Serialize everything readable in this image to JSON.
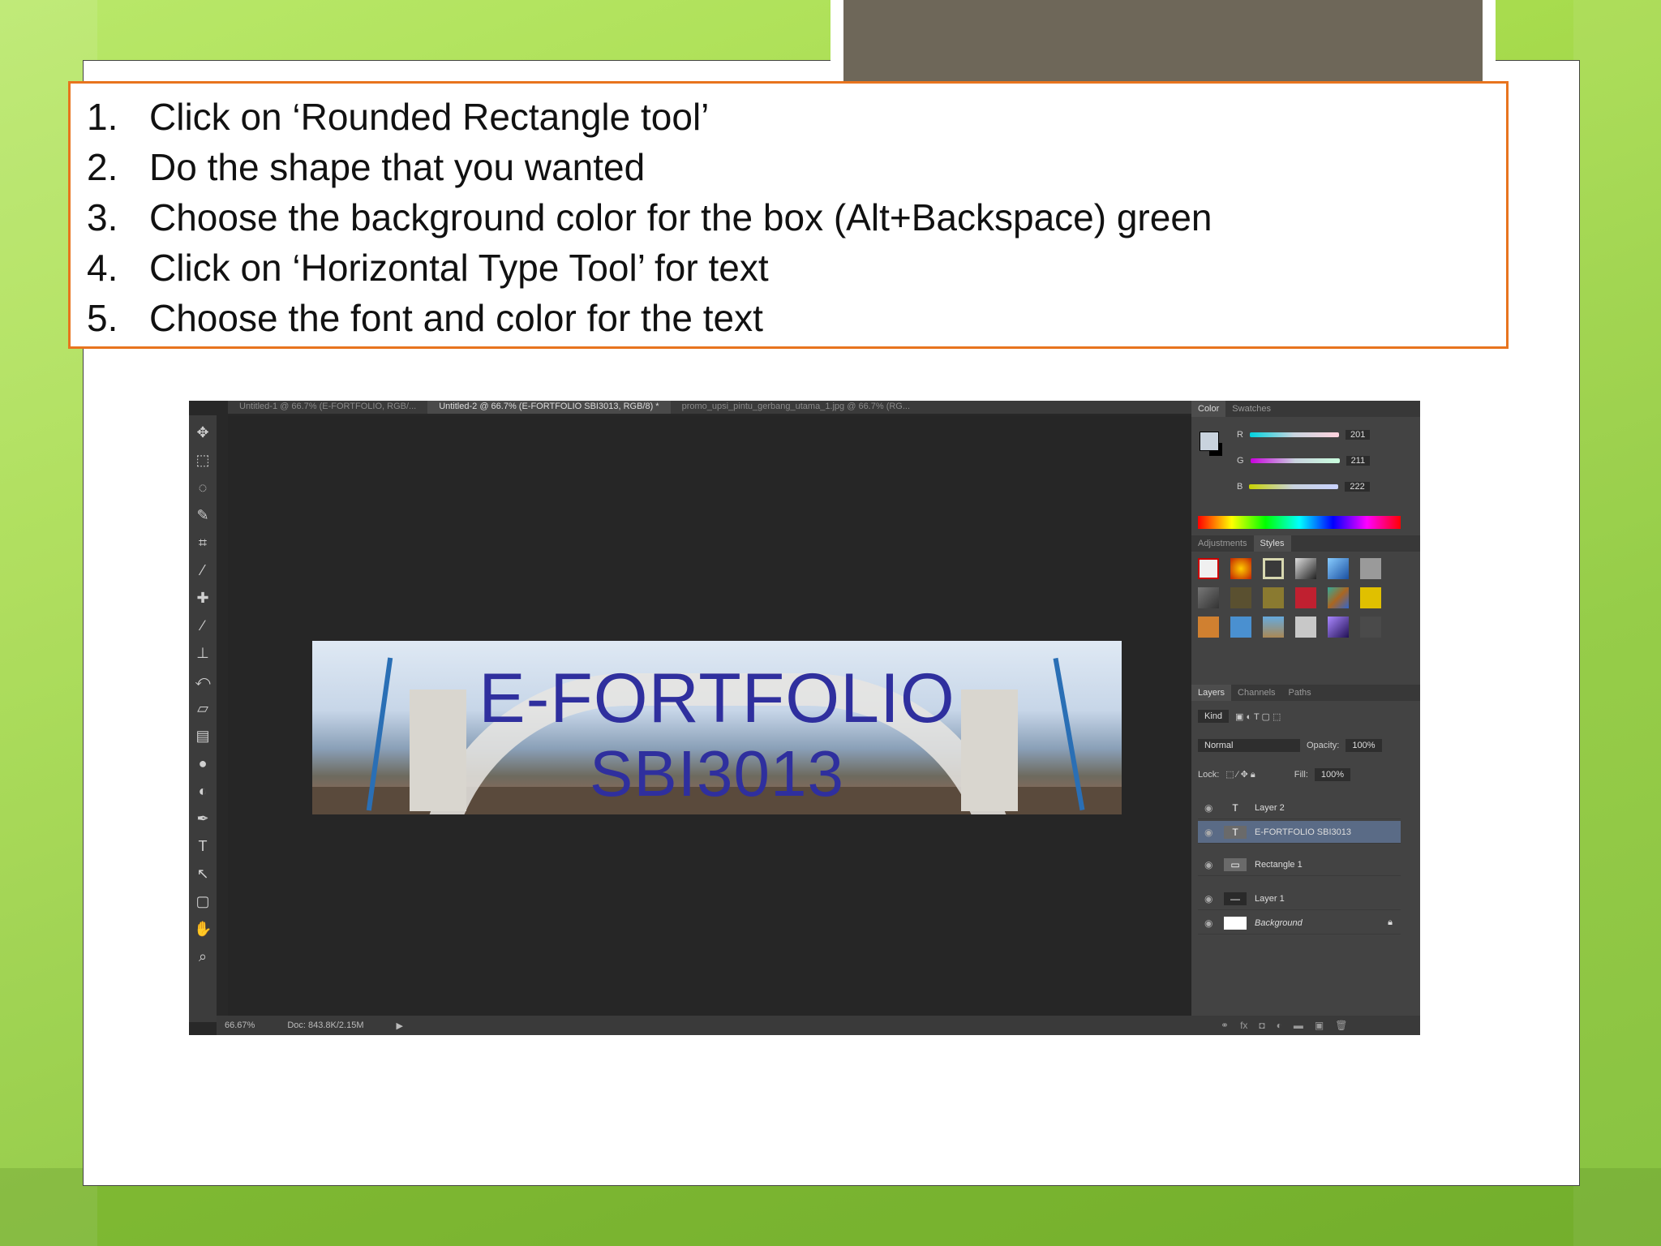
{
  "instructions": [
    {
      "num": "1.",
      "text": "Click on ‘Rounded Rectangle tool’"
    },
    {
      "num": "2.",
      "text": "Do the shape that you wanted"
    },
    {
      "num": "3.",
      "text": "Choose the background color for the box (Alt+Backspace) green"
    },
    {
      "num": "4.",
      "text": "Click on ‘Horizontal Type Tool’ for text"
    },
    {
      "num": "5.",
      "text": "Choose the font and color for the text"
    }
  ],
  "photoshop": {
    "tabs": [
      "Untitled-1 @ 66.7% (E-FORTFOLIO, RGB/...",
      "Untitled-2 @ 66.7% (E-FORTFOLIO SBI3013, RGB/8) *",
      "promo_upsi_pintu_gerbang_utama_1.jpg @ 66.7% (RG..."
    ],
    "banner_line1": "E-FORTFOLIO",
    "banner_line2": "SBI3013",
    "status_zoom": "66.67%",
    "status_doc": "Doc: 843.8K/2.15M",
    "color_tabs": [
      "Color",
      "Swatches"
    ],
    "color_values": {
      "r": "201",
      "g": "211",
      "b": "222"
    },
    "style_tabs": [
      "Adjustments",
      "Styles"
    ],
    "layer_tabs": [
      "Layers",
      "Channels",
      "Paths"
    ],
    "layer_kind": "Kind",
    "blend_mode": "Normal",
    "opacity_label": "Opacity:",
    "opacity_value": "100%",
    "lock_label": "Lock:",
    "fill_label": "Fill:",
    "fill_value": "100%",
    "layers": [
      {
        "name": "Layer 2",
        "thumb": "T"
      },
      {
        "name": "E-FORTFOLIO SBI3013",
        "thumb": "T"
      },
      {
        "name": "Rectangle 1",
        "thumb": "▭"
      },
      {
        "name": "Layer 1",
        "thumb": "—"
      },
      {
        "name": "Background",
        "thumb": ""
      }
    ]
  },
  "colors": {
    "accent_border": "#e8741e",
    "banner_text": "#2f2f9e",
    "selected_layer": "#5a6b86"
  }
}
